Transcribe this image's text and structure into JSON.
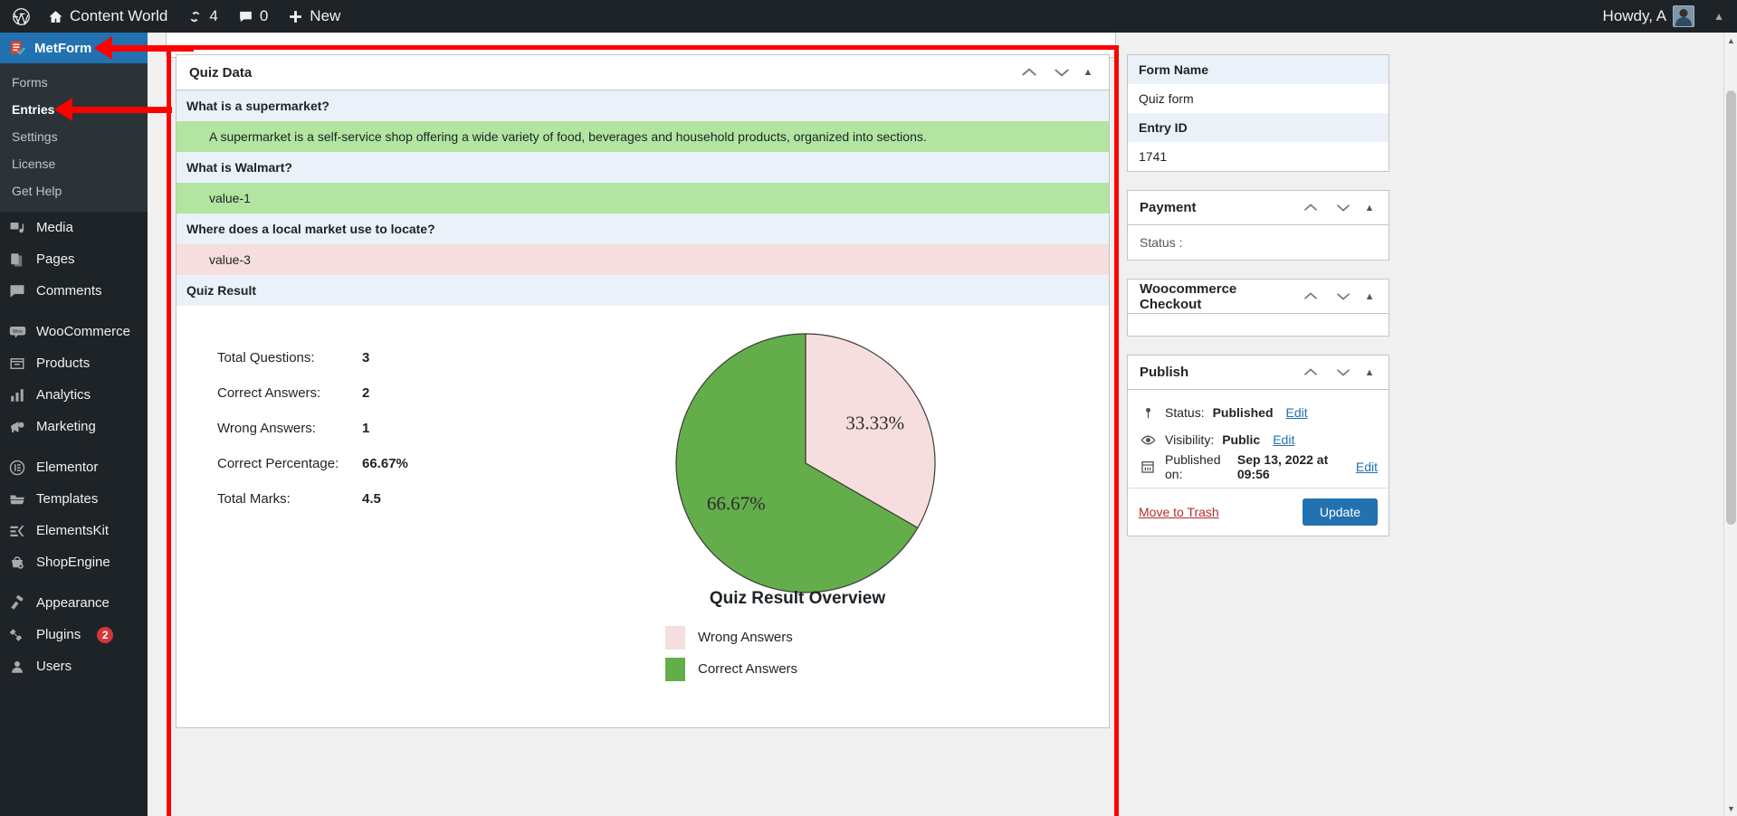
{
  "adminbar": {
    "site_name": "Content World",
    "updates_count": "4",
    "comments_count": "0",
    "new_label": "New",
    "howdy": "Howdy, A"
  },
  "sidebar": {
    "current_menu": "MetForm",
    "submenu": [
      {
        "label": "Forms",
        "current": false
      },
      {
        "label": "Entries",
        "current": true
      },
      {
        "label": "Settings",
        "current": false
      },
      {
        "label": "License",
        "current": false
      },
      {
        "label": "Get Help",
        "current": false
      }
    ],
    "items": [
      {
        "label": "Media",
        "icon": "media-icon",
        "badge": ""
      },
      {
        "label": "Pages",
        "icon": "pages-icon",
        "badge": ""
      },
      {
        "label": "Comments",
        "icon": "comments-icon",
        "badge": ""
      },
      {
        "label": "WooCommerce",
        "icon": "woo-icon",
        "badge": "",
        "gap": true
      },
      {
        "label": "Products",
        "icon": "products-icon",
        "badge": ""
      },
      {
        "label": "Analytics",
        "icon": "analytics-icon",
        "badge": ""
      },
      {
        "label": "Marketing",
        "icon": "marketing-icon",
        "badge": ""
      },
      {
        "label": "Elementor",
        "icon": "elementor-icon",
        "badge": "",
        "gap": true
      },
      {
        "label": "Templates",
        "icon": "templates-icon",
        "badge": ""
      },
      {
        "label": "ElementsKit",
        "icon": "elementskit-icon",
        "badge": ""
      },
      {
        "label": "ShopEngine",
        "icon": "shopengine-icon",
        "badge": ""
      },
      {
        "label": "Appearance",
        "icon": "appearance-icon",
        "badge": "",
        "gap": true
      },
      {
        "label": "Plugins",
        "icon": "plugins-icon",
        "badge": "2"
      },
      {
        "label": "Users",
        "icon": "users-icon",
        "badge": ""
      }
    ]
  },
  "quiz_panel": {
    "title": "Quiz Data",
    "rows": [
      {
        "question": "What is a supermarket?",
        "answer": "A supermarket is a self-service shop offering a wide variety of food, beverages and household products, organized into sections.",
        "state": "correct"
      },
      {
        "question": "What is Walmart?",
        "answer": "value-1",
        "state": "correct"
      },
      {
        "question": "Where does a local market use to locate?",
        "answer": "value-3",
        "state": "wrong"
      }
    ],
    "result_header": "Quiz Result",
    "stats": [
      {
        "label": "Total Questions:",
        "value": "3"
      },
      {
        "label": "Correct Answers:",
        "value": "2"
      },
      {
        "label": "Wrong Answers:",
        "value": "1"
      },
      {
        "label": "Correct Percentage:",
        "value": "66.67%"
      },
      {
        "label": "Total Marks:",
        "value": "4.5"
      }
    ]
  },
  "chart_data": {
    "type": "pie",
    "title": "Quiz Result Overview",
    "categories": [
      "Wrong Answers",
      "Correct Answers"
    ],
    "values": [
      33.33,
      66.67
    ],
    "labels": [
      "33.33%",
      "66.67%"
    ],
    "colors": [
      "#f5dedd",
      "#63ae4b"
    ],
    "legend_position": "bottom",
    "units": "percent"
  },
  "side": {
    "form_info": {
      "form_name_key": "Form Name",
      "form_name_value": "Quiz form",
      "entry_id_key": "Entry ID",
      "entry_id_value": "1741"
    },
    "payment": {
      "title": "Payment",
      "status_label": "Status :"
    },
    "woocommerce": {
      "title": "Woocommerce Checkout"
    },
    "publish": {
      "title": "Publish",
      "status_prefix": "Status:",
      "status_value": "Published",
      "status_edit": "Edit",
      "visibility_prefix": "Visibility:",
      "visibility_value": "Public",
      "visibility_edit": "Edit",
      "published_prefix": "Published on:",
      "published_value": "Sep 13, 2022 at 09:56",
      "published_edit": "Edit",
      "trash_label": "Move to Trash",
      "update_label": "Update"
    }
  }
}
